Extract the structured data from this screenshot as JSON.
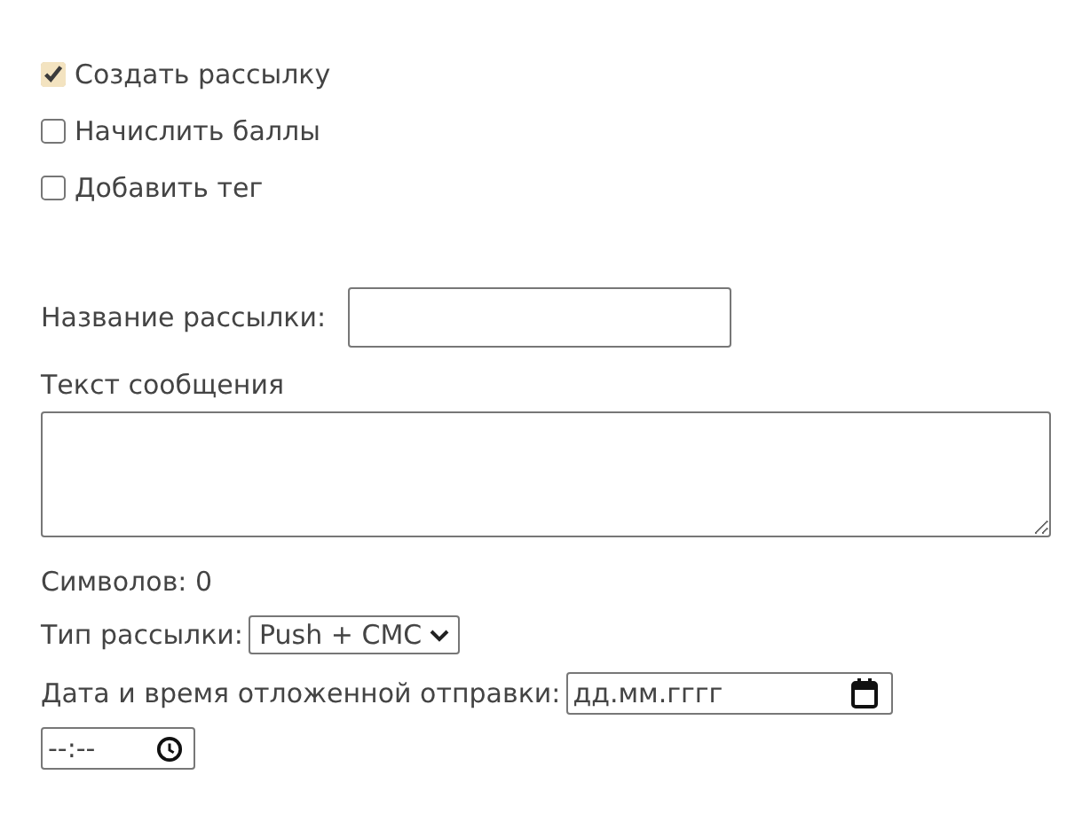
{
  "options": [
    {
      "label": "Создать рассылку",
      "checked": true
    },
    {
      "label": "Начислить баллы",
      "checked": false
    },
    {
      "label": "Добавить тег",
      "checked": false
    }
  ],
  "name_field": {
    "label": "Название рассылки:"
  },
  "message": {
    "label": "Текст сообщения"
  },
  "char_count": "Символов: 0",
  "send_type": {
    "label": "Тип рассылки:",
    "value": "Push + СМС"
  },
  "schedule": {
    "label": "Дата и время отложенной отправки:",
    "date_placeholder": "дд.мм.гггг",
    "time_placeholder": "--:--"
  }
}
